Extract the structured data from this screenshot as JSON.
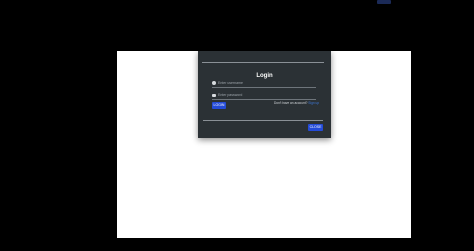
{
  "modal": {
    "title": "Login",
    "username_placeholder": "Enter username",
    "password_placeholder": "Enter password",
    "login_button": "LOGIN",
    "account_prompt": "Don't have an account?",
    "signup_link": "Sign up",
    "close_button": "CLOSE"
  },
  "icons": {
    "username": "user-icon",
    "password": "lock-icon"
  },
  "colors": {
    "modal_background": "#2b3135",
    "button_primary": "#244bd8",
    "link": "#3e78d8",
    "backdrop_panel": "#ffffff"
  }
}
